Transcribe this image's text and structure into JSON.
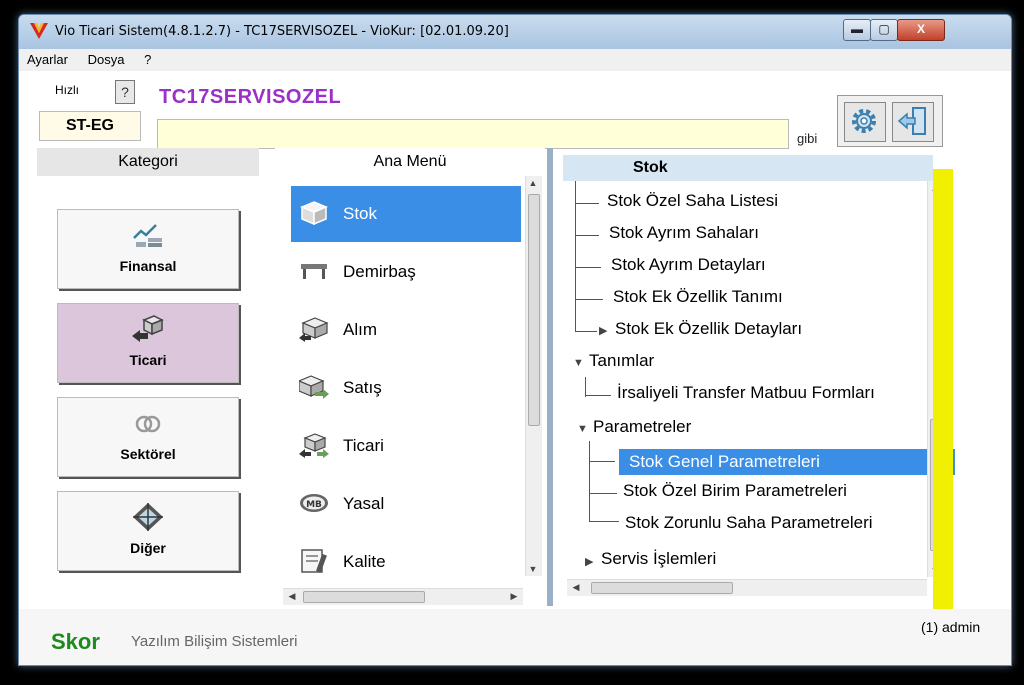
{
  "window": {
    "title": "Vio Ticari Sistem(4.8.1.2.7)  - TC17SERVISOZEL - VioKur: [02.01.09.20]",
    "min_label": "▬",
    "max_label": "▢",
    "close_label": "X"
  },
  "menu": [
    "Ayarlar",
    "Dosya",
    "?"
  ],
  "toolbar": {
    "hizli_label": "Hızlı",
    "help_label": "?",
    "company": "TC17SERVISOZEL",
    "code": "ST-EG",
    "search_value": "",
    "gibi_label": "gibi"
  },
  "kategori": {
    "header": "Kategori",
    "items": [
      {
        "label": "Finansal",
        "icon": "chart-coins-icon",
        "active": false
      },
      {
        "label": "Ticari",
        "icon": "trade-box-icon",
        "active": true
      },
      {
        "label": "Sektörel",
        "icon": "rings-icon",
        "active": false
      },
      {
        "label": "Diğer",
        "icon": "diamond-icon",
        "active": false
      }
    ]
  },
  "ana_menu": {
    "header": "Ana Menü",
    "items": [
      {
        "label": "Stok",
        "icon": "box-icon",
        "selected": true
      },
      {
        "label": "Demirbaş",
        "icon": "table-icon",
        "selected": false
      },
      {
        "label": "Alım",
        "icon": "box-in-icon",
        "selected": false
      },
      {
        "label": "Satış",
        "icon": "box-out-icon",
        "selected": false
      },
      {
        "label": "Ticari",
        "icon": "trade-box-icon",
        "selected": false
      },
      {
        "label": "Yasal",
        "icon": "mb-badge-icon",
        "selected": false
      },
      {
        "label": "Kalite",
        "icon": "tools-icon",
        "selected": false
      }
    ]
  },
  "stok": {
    "header": "Stok",
    "tree": [
      {
        "label": "Stok Özel Saha Listesi"
      },
      {
        "label": "Stok Ayrım Sahaları"
      },
      {
        "label": "Stok Ayrım Detayları"
      },
      {
        "label": "Stok Ek Özellik Tanımı"
      },
      {
        "label": "Stok Ek Özellik Detayları"
      },
      {
        "label": "Tanımlar"
      },
      {
        "label": "İrsaliyeli Transfer Matbuu Formları"
      },
      {
        "label": "Parametreler"
      },
      {
        "label": "Stok Genel Parametreleri",
        "selected": true
      },
      {
        "label": "Stok Özel Birim Parametreleri"
      },
      {
        "label": "Stok Zorunlu Saha Parametreleri"
      },
      {
        "label": "Servis İşlemleri"
      }
    ]
  },
  "status": {
    "brand": "Skor",
    "company": "Yazılım Bilişim Sistemleri",
    "user": "(1) admin"
  },
  "colors": {
    "accent": "#3a8ee6",
    "company": "#9b30c8",
    "brand": "#1e8a1e",
    "active_category": "#dcc6dc",
    "highlight_bar": "#f0f000"
  }
}
